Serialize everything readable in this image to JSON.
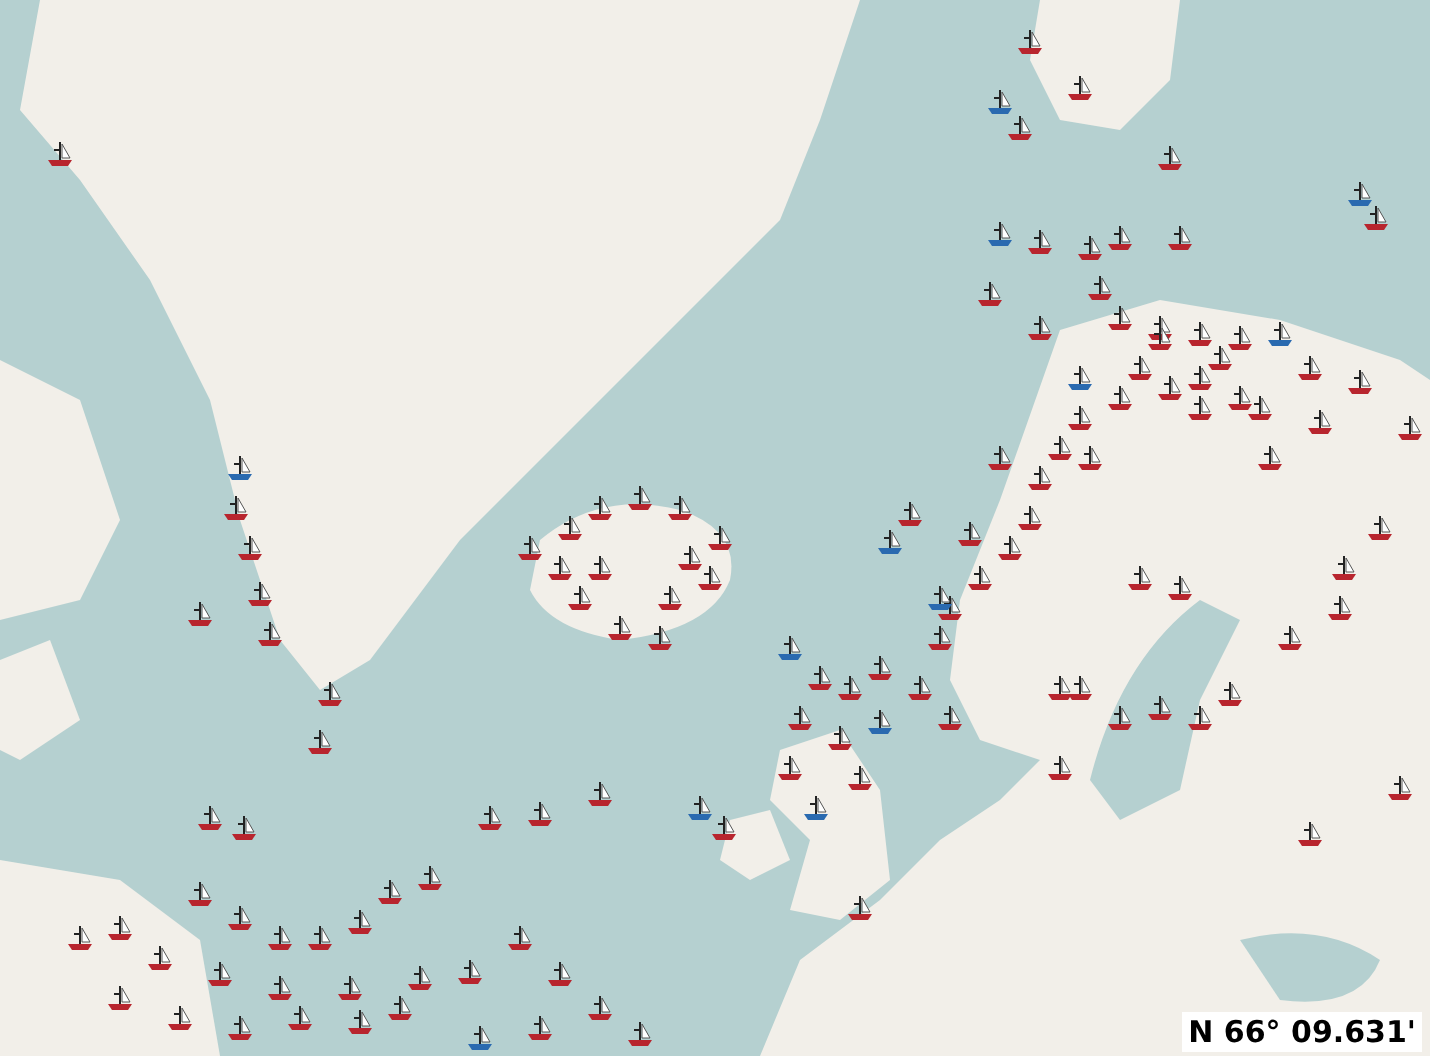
{
  "coordinate_readout": "N 66° 09.631'"
}
